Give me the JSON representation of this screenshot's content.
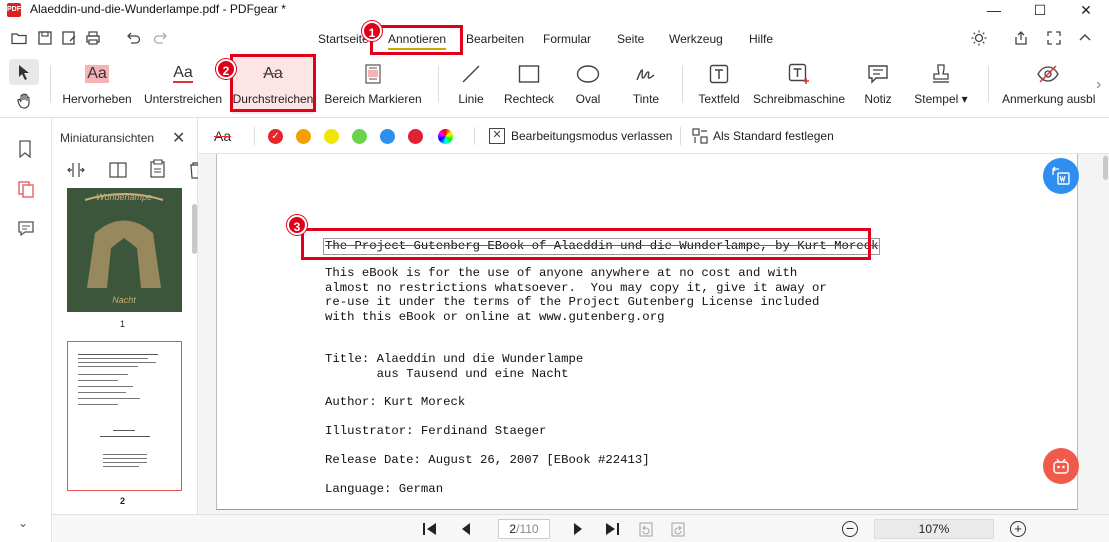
{
  "window": {
    "title": "Alaeddin-und-die-Wunderlampe.pdf - PDFgear *",
    "logo_text": "PDF",
    "minimize": "—",
    "maximize": "☐",
    "close": "✕"
  },
  "menu": {
    "tabs": [
      "Startseite",
      "Annotieren",
      "Bearbeiten",
      "Formular",
      "Seite",
      "Werkzeug",
      "Hilfe"
    ],
    "active": "Annotieren"
  },
  "ribbon": {
    "tools": [
      {
        "label": "Hervorheben"
      },
      {
        "label": "Unterstreichen"
      },
      {
        "label": "Durchstreichen"
      },
      {
        "label": "Bereich Markieren"
      },
      {
        "label": "Linie"
      },
      {
        "label": "Rechteck"
      },
      {
        "label": "Oval"
      },
      {
        "label": "Tinte"
      },
      {
        "label": "Textfeld"
      },
      {
        "label": "Schreibmaschine"
      },
      {
        "label": "Notiz"
      },
      {
        "label": "Stempel ▾"
      },
      {
        "label": "Anmerkung ausbl"
      }
    ]
  },
  "thumbnails": {
    "title": "Miniaturansichten",
    "pages": [
      {
        "number": "1"
      },
      {
        "number": "2"
      }
    ]
  },
  "subtoolbar": {
    "colors": [
      "#e8262a",
      "#f5a000",
      "#f2e600",
      "#6cd44a",
      "#2f8ff0",
      "#e0213a"
    ],
    "exit_edit": "Bearbeitungsmodus verlassen",
    "set_default": "Als Standard festlegen"
  },
  "document": {
    "heading": "The Project Gutenberg EBook of Alaeddin und die Wunderlampe, by Kurt Moreck",
    "paragraph": "This eBook is for the use of anyone anywhere at no cost and with\nalmost no restrictions whatsoever.  You may copy it, give it away or\nre-use it under the terms of the Project Gutenberg License included\nwith this eBook or online at www.gutenberg.org",
    "title_block": "Title: Alaeddin und die Wunderlampe\n       aus Tausend und eine Nacht",
    "author": "Author: Kurt Moreck",
    "illustrator": "Illustrator: Ferdinand Staeger",
    "release": "Release Date: August 26, 2007 [EBook #22413]",
    "language": "Language: German"
  },
  "navigation": {
    "page_current": "2",
    "page_total": "/110",
    "zoom": "107%"
  },
  "annotations": {
    "badge1": "1",
    "badge2": "2",
    "badge3": "3"
  }
}
